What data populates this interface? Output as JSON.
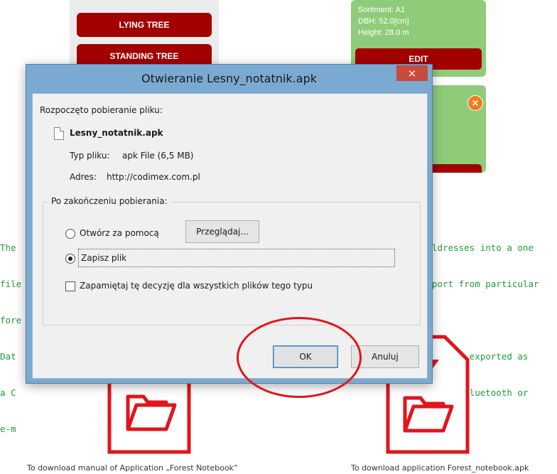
{
  "background": {
    "left_app": {
      "buttons": [
        "LYING TREE",
        "STANDING TREE"
      ]
    },
    "right_app": {
      "card_lines": [
        "Sortiment: A1",
        "DBH: 52.0[cm]",
        "Height: 28.0 m"
      ],
      "edit_label": "EDIT"
    },
    "green_text_left": [
      "The",
      "file",
      "fore",
      "Dat",
      "a C",
      "e-m"
    ],
    "green_text_right": [
      "ldresses into a one",
      "port from particular",
      "",
      "can be exported as",
      "g via Bluetooth or"
    ],
    "captions": {
      "manual": "To download manual of Application „Forest Notebook”",
      "app": "To download application Forest_notebook.apk"
    }
  },
  "dialog": {
    "title": "Otwieranie Lesny_notatnik.apk",
    "close_label": "×",
    "started_label": "Rozpoczęto pobieranie pliku:",
    "file_name": "Lesny_notatnik.apk",
    "file_type_label": "Typ pliku:",
    "file_type_value": "apk File (6,5 MB)",
    "address_label": "Adres:",
    "address_value": "http://codimex.com.pl",
    "group_label": "Po zakończeniu pobierania:",
    "open_with_label": "Otwórz za pomocą",
    "browse_label": "Przeglądaj...",
    "save_file_label": "Zapisz plik",
    "remember_label": "Zapamiętaj tę decyzję dla wszystkich plików tego typu",
    "ok_label": "OK",
    "cancel_label": "Anuluj"
  },
  "colors": {
    "accent_red": "#a30000",
    "card_green": "#8fcc7a",
    "text_green": "#1f9c35",
    "annotation_red": "#e3141b"
  }
}
